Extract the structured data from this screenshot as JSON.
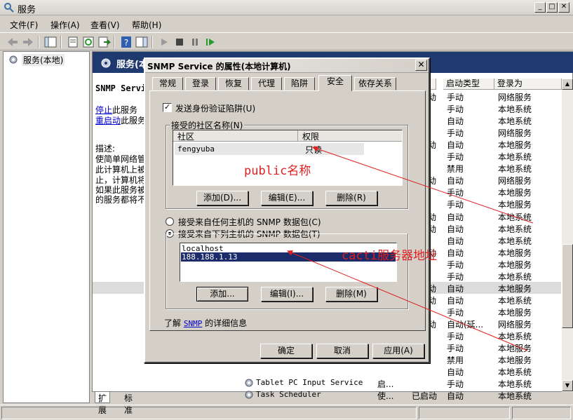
{
  "window": {
    "title": "服务"
  },
  "menu": [
    "文件(F)",
    "操作(A)",
    "查看(V)",
    "帮助(H)"
  ],
  "tree": {
    "root_label": "服务(本地)"
  },
  "right_pane": {
    "header_title": "服务(本地)",
    "service_name": "SNMP Servi",
    "stop_link": "停止",
    "stop_suffix": "此服务",
    "restart_link": "重启动",
    "restart_suffix": "此服务",
    "description_label": "描述:",
    "description_lines": [
      "使简单网络管",
      "此计算机上被",
      "止，计算机将",
      "如果此服务被",
      "的服务都将不"
    ],
    "columns": [
      "启动类型",
      "登录为"
    ],
    "rows": [
      {
        "c0": "动",
        "type": "手动",
        "logon": "网络服务"
      },
      {
        "c0": "",
        "type": "手动",
        "logon": "本地系统"
      },
      {
        "c0": "",
        "type": "自动",
        "logon": "本地系统"
      },
      {
        "c0": "",
        "type": "手动",
        "logon": "网络服务"
      },
      {
        "c0": "动",
        "type": "自动",
        "logon": "本地服务"
      },
      {
        "c0": "",
        "type": "手动",
        "logon": "本地系统"
      },
      {
        "c0": "",
        "type": "禁用",
        "logon": "本地系统"
      },
      {
        "c0": "动",
        "type": "自动",
        "logon": "网络服务"
      },
      {
        "c0": "",
        "type": "手动",
        "logon": "本地服务"
      },
      {
        "c0": "",
        "type": "手动",
        "logon": "本地服务"
      },
      {
        "c0": "动",
        "type": "自动",
        "logon": "本地系统"
      },
      {
        "c0": "动",
        "type": "自动",
        "logon": "本地系统"
      },
      {
        "c0": "",
        "type": "自动",
        "logon": "本地系统"
      },
      {
        "c0": "动",
        "type": "自动",
        "logon": "本地服务"
      },
      {
        "c0": "",
        "type": "手动",
        "logon": "本地服务"
      },
      {
        "c0": "",
        "type": "手动",
        "logon": "本地系统"
      },
      {
        "c0": "动",
        "type": "自动",
        "logon": "本地服务"
      },
      {
        "c0": "动",
        "type": "自动",
        "logon": "本地系统"
      },
      {
        "c0": "",
        "type": "手动",
        "logon": "本地服务"
      },
      {
        "c0": "动",
        "type": "自动(延...",
        "logon": "网络服务"
      },
      {
        "c0": "",
        "type": "手动",
        "logon": "本地系统"
      },
      {
        "c0": "",
        "type": "手动",
        "logon": "本地服务"
      },
      {
        "c0": "",
        "type": "禁用",
        "logon": "本地服务"
      },
      {
        "c0": "",
        "type": "自动",
        "logon": "本地系统"
      }
    ],
    "bottom_rows": [
      {
        "name": "Tablet PC Input Service",
        "desc": "启...",
        "status": "",
        "type": "手动",
        "logon": "本地系统"
      },
      {
        "name": "Task Scheduler",
        "desc": "使...",
        "status": "已启动",
        "type": "自动",
        "logon": "本地系统"
      }
    ],
    "selected_row_index": 16
  },
  "bottom_tabs": [
    "扩展",
    "标准"
  ],
  "dialog": {
    "title": "SNMP Service 的属性(本地计算机)",
    "tabs": [
      "常规",
      "登录",
      "恢复",
      "代理",
      "陷阱",
      "安全",
      "依存关系"
    ],
    "active_tab": "安全",
    "send_auth_trap_label": "发送身份验证陷阱(U)",
    "send_auth_trap_checked": true,
    "community_group_label": "接受的社区名称(N)",
    "community_columns": [
      "社区",
      "权限"
    ],
    "communities": [
      {
        "name": "fengyuba",
        "rights": "只读"
      }
    ],
    "btn_add1": "添加(D)...",
    "btn_edit1": "编辑(E)...",
    "btn_remove1": "删除(R)",
    "radio_any": "接受来自任何主机的 SNMP 数据包(C)",
    "radio_these": "接受来自下列主机的 SNMP 数据包(T)",
    "radio_selected": "these",
    "hosts": [
      "localhost",
      "188.188.1.13"
    ],
    "selected_host_index": 1,
    "btn_add2": "添加...",
    "btn_edit2": "编辑(I)...",
    "btn_remove2": "删除(M)",
    "learn_prefix": "了解",
    "learn_link": "SNMP",
    "learn_suffix": "的详细信息",
    "btn_ok": "确定",
    "btn_cancel": "取消",
    "btn_apply": "应用(A)"
  },
  "annotations": {
    "public_label": "public名称",
    "cacti_label": "cacti服务器地址",
    "color": "#e02020"
  }
}
